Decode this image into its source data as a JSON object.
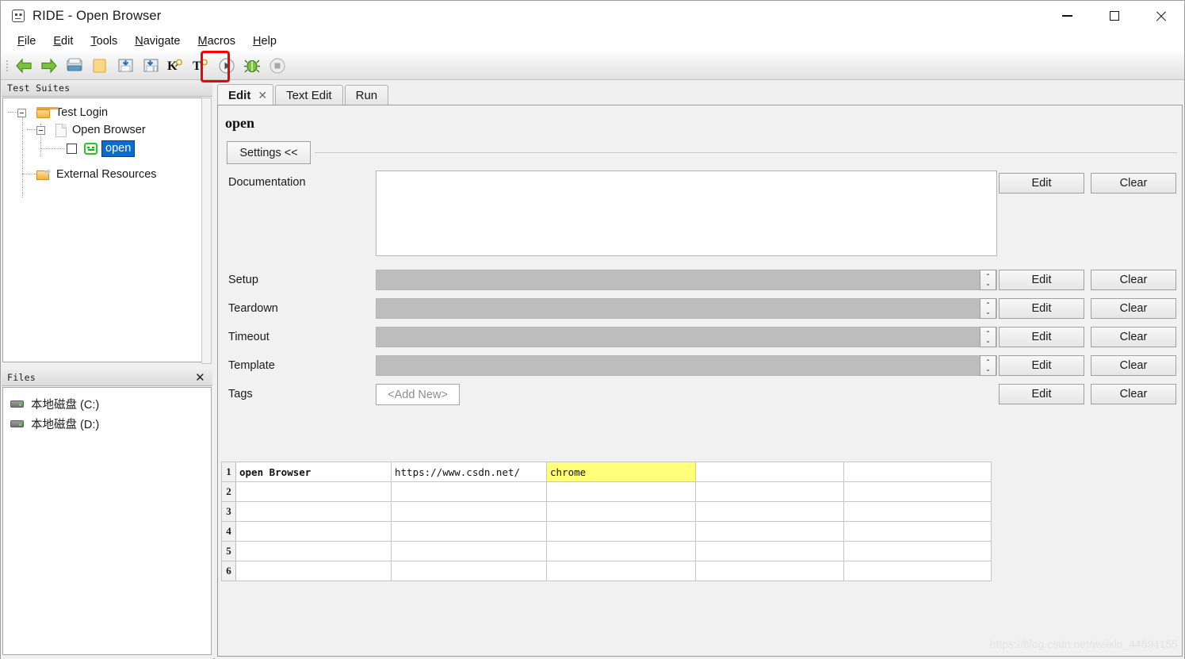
{
  "window": {
    "title": "RIDE - Open Browser",
    "icon": "robot-app-icon",
    "minimize": "−",
    "maximize": "□",
    "close": "✕"
  },
  "menubar": {
    "items": [
      {
        "label": "File",
        "mnemonic": "F"
      },
      {
        "label": "Edit",
        "mnemonic": "E"
      },
      {
        "label": "Tools",
        "mnemonic": "T"
      },
      {
        "label": "Navigate",
        "mnemonic": "N"
      },
      {
        "label": "Macros",
        "mnemonic": "M"
      },
      {
        "label": "Help",
        "mnemonic": "H"
      }
    ]
  },
  "toolbar": {
    "buttons": [
      {
        "name": "back-arrow-icon",
        "tip": "Back"
      },
      {
        "name": "forward-arrow-icon",
        "tip": "Forward"
      },
      {
        "name": "open-folder-icon",
        "tip": "Open"
      },
      {
        "name": "new-folder-icon",
        "tip": "New Project"
      },
      {
        "name": "save-icon",
        "tip": "Save"
      },
      {
        "name": "save-all-icon",
        "tip": "Save All"
      },
      {
        "name": "search-keyword-icon",
        "tip": "Search Keywords"
      },
      {
        "name": "search-tests-icon",
        "tip": "Search Tests"
      },
      {
        "name": "run-play-icon",
        "tip": "Start"
      },
      {
        "name": "debug-bug-icon",
        "tip": "Debug"
      },
      {
        "name": "stop-icon",
        "tip": "Stop"
      }
    ],
    "highlight_color": "#f70000"
  },
  "left": {
    "tree_panel": {
      "header": "Test Suites",
      "nodes": [
        {
          "label": "Test Login",
          "icon": "folder-icon",
          "level": 0,
          "expanded": true,
          "selected": false
        },
        {
          "label": "Open Browser",
          "icon": "document-icon",
          "level": 1,
          "expanded": true,
          "selected": false
        },
        {
          "label": "open",
          "icon": "robot-testcase-icon",
          "level": 2,
          "expanded": false,
          "selected": true,
          "checkbox": false
        },
        {
          "label": "External Resources",
          "icon": "external-resources-icon",
          "level": 1,
          "expanded": false,
          "selected": false
        }
      ]
    },
    "files_panel": {
      "header": "Files",
      "close": "✕",
      "items": [
        {
          "label": "本地磁盘 (C:)",
          "icon": "drive-icon"
        },
        {
          "label": "本地磁盘 (D:)",
          "icon": "drive-icon"
        }
      ]
    }
  },
  "main": {
    "tabs": [
      {
        "label": "Edit",
        "active": true,
        "closable": true,
        "close": "✕"
      },
      {
        "label": "Text Edit",
        "active": false,
        "closable": false
      },
      {
        "label": "Run",
        "active": false,
        "closable": false
      }
    ],
    "keyword_title": "open",
    "settings_button": "Settings <<",
    "settings_rows": [
      {
        "label": "Documentation",
        "type": "textarea",
        "value": "",
        "edit": "Edit",
        "clear": "Clear"
      },
      {
        "label": "Setup",
        "type": "combo",
        "value": "",
        "edit": "Edit",
        "clear": "Clear"
      },
      {
        "label": "Teardown",
        "type": "combo",
        "value": "",
        "edit": "Edit",
        "clear": "Clear"
      },
      {
        "label": "Timeout",
        "type": "combo",
        "value": "",
        "edit": "Edit",
        "clear": "Clear"
      },
      {
        "label": "Template",
        "type": "combo",
        "value": "",
        "edit": "Edit",
        "clear": "Clear"
      },
      {
        "label": "Tags",
        "type": "addnew",
        "value": "<Add New>",
        "edit": "Edit",
        "clear": "Clear"
      }
    ],
    "grid": {
      "row_count": 6,
      "column_count": 5,
      "rows": [
        {
          "num": "1",
          "cells": [
            "open Browser",
            "https://www.csdn.net/",
            "chrome",
            "",
            ""
          ],
          "bold_first": true,
          "highlight_index": 2
        },
        {
          "num": "2",
          "cells": [
            "",
            "",
            "",
            "",
            ""
          ],
          "bold_first": false,
          "highlight_index": -1
        },
        {
          "num": "3",
          "cells": [
            "",
            "",
            "",
            "",
            ""
          ],
          "bold_first": false,
          "highlight_index": -1
        },
        {
          "num": "4",
          "cells": [
            "",
            "",
            "",
            "",
            ""
          ],
          "bold_first": false,
          "highlight_index": -1
        },
        {
          "num": "5",
          "cells": [
            "",
            "",
            "",
            "",
            ""
          ],
          "bold_first": false,
          "highlight_index": -1
        },
        {
          "num": "6",
          "cells": [
            "",
            "",
            "",
            "",
            ""
          ],
          "bold_first": false,
          "highlight_index": -1
        }
      ],
      "highlight_color": "#ffff7a"
    }
  },
  "watermark": "https://blog.csdn.net/weixin_44694155"
}
